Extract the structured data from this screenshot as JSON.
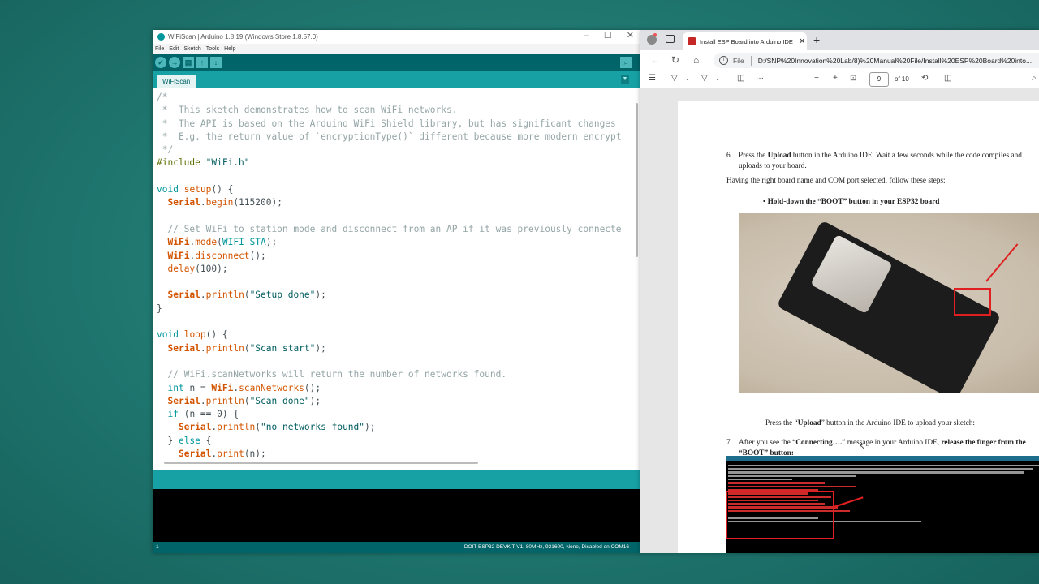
{
  "arduino": {
    "window_title": "WiFiScan | Arduino 1.8.19 (Windows Store 1.8.57.0)",
    "window_buttons": [
      "–",
      "☐",
      "✕"
    ],
    "menu": [
      "File",
      "Edit",
      "Sketch",
      "Tools",
      "Help"
    ],
    "toolbar": {
      "verify": "✓",
      "upload": "→",
      "new": "▤",
      "open": "↑",
      "save": "↓",
      "serial_monitor": "⌕"
    },
    "tab": "WiFiScan",
    "tab_menu": "▼",
    "code_lines": [
      "/*",
      " *  This sketch demonstrates how to scan WiFi networks.",
      " *  The API is based on the Arduino WiFi Shield library, but has significant changes",
      " *  E.g. the return value of `encryptionType()` different because more modern encrypt",
      " */",
      "#include \"WiFi.h\"",
      "",
      "void setup() {",
      "  Serial.begin(115200);",
      "",
      "  // Set WiFi to station mode and disconnect from an AP if it was previously connecte",
      "  WiFi.mode(WIFI_STA);",
      "  WiFi.disconnect();",
      "  delay(100);",
      "",
      "  Serial.println(\"Setup done\");",
      "}",
      "",
      "void loop() {",
      "  Serial.println(\"Scan start\");",
      "",
      "  // WiFi.scanNetworks will return the number of networks found.",
      "  int n = WiFi.scanNetworks();",
      "  Serial.println(\"Scan done\");",
      "  if (n == 0) {",
      "    Serial.println(\"no networks found\");",
      "  } else {",
      "    Serial.print(n);"
    ],
    "footer": {
      "line_number": "1",
      "board_info": "DOIT ESP32 DEVKIT V1, 80MHz, 921600, None, Disabled on COM16"
    }
  },
  "edge": {
    "tab_title": "Install ESP Board into Arduino IDE",
    "tab_close": "✕",
    "new_tab": "+",
    "nav": {
      "back": "←",
      "refresh": "↻",
      "home": "⌂"
    },
    "address": {
      "file_label": "File",
      "url": "D:/SNP%20Innovation%20Lab/8)%20Manual%20File/Install%20ESP%20Board%20into..."
    },
    "pdf_toolbar": {
      "contents": "☰",
      "draw": "▽",
      "highlight": "▽",
      "erase": "◫",
      "more": "···",
      "zoom_out": "−",
      "zoom_in": "+",
      "fit": "⊡",
      "page_current": "9",
      "page_total": "of 10",
      "rotate": "⟲",
      "page_view": "◫",
      "search": "⌕"
    },
    "document": {
      "step6_number": "6.",
      "step6_text_a": "Press the ",
      "step6_bold": "Upload",
      "step6_text_b": " button in the Arduino IDE. Wait a few seconds while the code compiles and uploads to your board.",
      "board_para": "Having the right board name and COM port selected, follow these steps:",
      "bullet": "•   Hold-down the “BOOT” button in your ESP32 board",
      "upload_para_a": "Press the “",
      "upload_para_bold": "Upload",
      "upload_para_b": "” button in the Arduino IDE to upload your sketch:",
      "step7_number": "7.",
      "step7_text_a": "After you see the  “",
      "step7_bold1": "Connecting….",
      "step7_text_b": "” message in your Arduino IDE, ",
      "step7_bold2": "release the finger from the “BOOT” button:"
    }
  }
}
